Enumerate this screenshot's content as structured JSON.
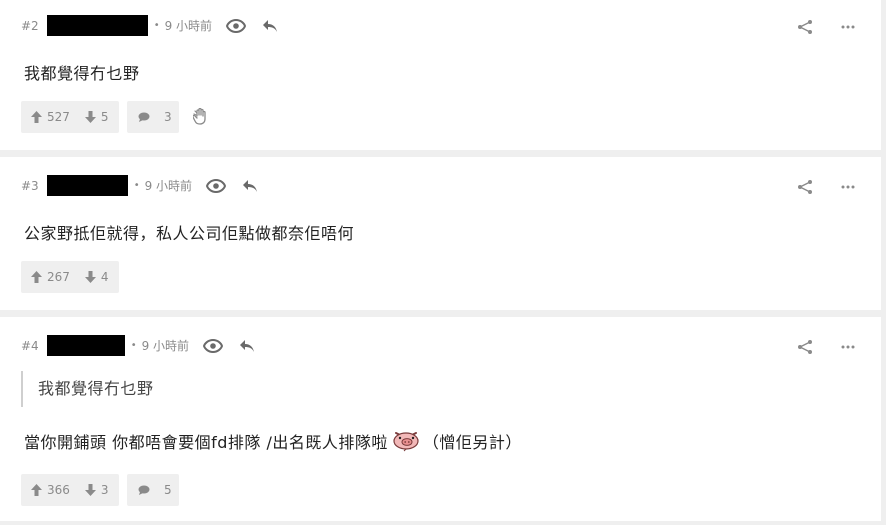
{
  "posts": [
    {
      "number": "#2",
      "time": "9 小時前",
      "content": "我都覺得冇乜野",
      "upvotes": "527",
      "downvotes": "5",
      "comments": "3"
    },
    {
      "number": "#3",
      "time": "9 小時前",
      "content": "公家野抵佢就得，私人公司佢點做都奈佢唔何",
      "upvotes": "267",
      "downvotes": "4"
    },
    {
      "number": "#4",
      "time": "9 小時前",
      "quote": "我都覺得冇乜野",
      "content_before_emoji": "當你開鋪頭 你都唔會要個fd排隊 /出名既人排隊啦",
      "content_after_emoji": "（憎佢另計）",
      "emoji_icon": "pig-emoji-icon",
      "upvotes": "366",
      "downvotes": "3",
      "comments": "5"
    }
  ],
  "icons": {
    "view": "eye-icon",
    "reply": "reply-arrow-icon",
    "share": "share-icon",
    "more": "more-dots-icon",
    "upvote": "thumb-up-arrow-icon",
    "downvote": "thumb-down-arrow-icon",
    "comment": "comment-bubble-icon",
    "report": "hand-icon"
  },
  "colors": {
    "page_bg": "#efefef",
    "card_bg": "#ffffff",
    "meta_text": "#8a8a8a",
    "redaction": "#000000"
  }
}
